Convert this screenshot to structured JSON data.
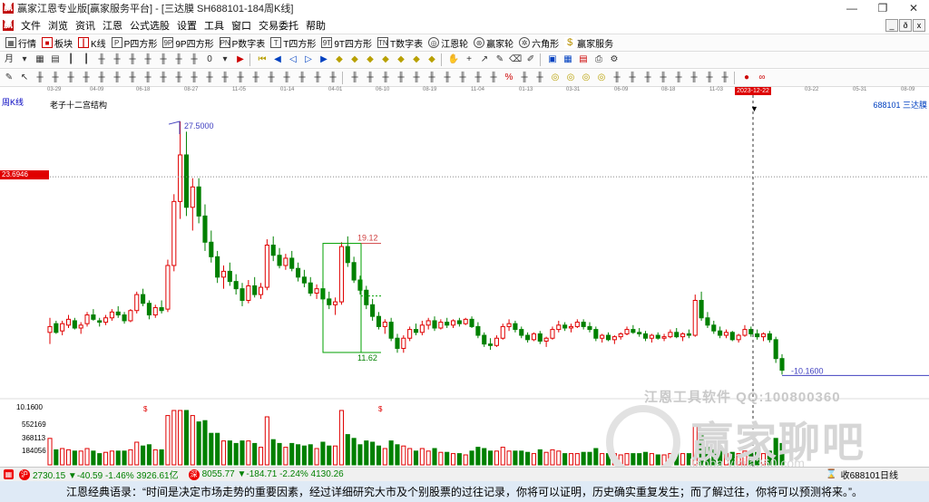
{
  "window": {
    "title": "赢家江恩专业版[赢家服务平台] - [三达膜  SH688101-184周K线]",
    "controls": [
      "—",
      "❐",
      "✕"
    ]
  },
  "menu": {
    "items": [
      "文件",
      "浏览",
      "资讯",
      "江恩",
      "公式选股",
      "设置",
      "工具",
      "窗口",
      "交易委托",
      "帮助"
    ],
    "right_controls": [
      "_",
      "ð",
      "x"
    ]
  },
  "toolbar1": [
    {
      "label": "行情",
      "icon": "grid-icon"
    },
    {
      "label": "板块",
      "icon": "blocks-icon"
    },
    {
      "label": "K线",
      "icon": "candle-icon"
    },
    {
      "label": "P四方形",
      "icon": "p-square-icon"
    },
    {
      "label": "9P四方形",
      "icon": "9p-square-icon"
    },
    {
      "label": "P数字表",
      "icon": "p-table-icon"
    },
    {
      "label": "T四方形",
      "icon": "t-square-icon"
    },
    {
      "label": "9T四方形",
      "icon": "9t-square-icon"
    },
    {
      "label": "T数字表",
      "icon": "t-table-icon"
    },
    {
      "label": "江恩轮",
      "icon": "gann-wheel-icon"
    },
    {
      "label": "赢家轮",
      "icon": "winner-wheel-icon"
    },
    {
      "label": "六角形",
      "icon": "hexagon-icon"
    },
    {
      "label": "赢家服务",
      "icon": "dollar-icon"
    }
  ],
  "chart": {
    "period_label": "周K线",
    "indicator_name": "老子十二宫结构",
    "stock_label": "688101  三达膜",
    "cursor_date": "2023-12-22",
    "dates": [
      "03-29",
      "04-09",
      "06-18",
      "08-27",
      "11-05",
      "01-14",
      "04-01",
      "06-10",
      "08-19",
      "11-04",
      "01-13",
      "03-31",
      "06-09",
      "08-18",
      "11-03",
      "2023-12-22",
      "03-22",
      "05-31",
      "08-09"
    ],
    "price_flag": "23.6946",
    "annotations": {
      "high": "27.5000",
      "box_top": "19.12",
      "box_bottom": "11.62",
      "low": "-10.1600"
    },
    "volume_labels": [
      "10.1600",
      "552169",
      "368113",
      "184056"
    ],
    "volume_markers": [
      "$",
      "$"
    ]
  },
  "chart_data": {
    "type": "candlestick",
    "ylim": [
      9.5,
      28.5
    ],
    "candles": [
      [
        13.0,
        14.0,
        12.2,
        13.4
      ],
      [
        13.6,
        13.8,
        12.9,
        13.0
      ],
      [
        13.1,
        13.8,
        12.8,
        13.6
      ],
      [
        13.5,
        14.2,
        13.3,
        13.9
      ],
      [
        13.8,
        14.0,
        13.2,
        13.3
      ],
      [
        13.3,
        13.7,
        12.9,
        13.5
      ],
      [
        13.6,
        14.4,
        13.4,
        14.2
      ],
      [
        14.2,
        14.6,
        13.8,
        13.9
      ],
      [
        13.8,
        14.0,
        13.4,
        13.7
      ],
      [
        13.7,
        14.2,
        13.5,
        14.0
      ],
      [
        14.0,
        14.6,
        13.8,
        14.4
      ],
      [
        14.4,
        14.8,
        14.0,
        14.2
      ],
      [
        14.2,
        14.4,
        13.6,
        13.8
      ],
      [
        13.8,
        14.6,
        13.7,
        14.5
      ],
      [
        14.5,
        15.8,
        14.3,
        15.6
      ],
      [
        15.6,
        16.0,
        14.8,
        15.0
      ],
      [
        15.0,
        15.2,
        13.9,
        14.2
      ],
      [
        14.2,
        14.9,
        14.0,
        14.7
      ],
      [
        14.7,
        15.2,
        14.3,
        14.5
      ],
      [
        14.6,
        18.0,
        14.4,
        17.6
      ],
      [
        17.6,
        22.5,
        17.2,
        22.0
      ],
      [
        22.0,
        27.5,
        20.8,
        25.2
      ],
      [
        25.2,
        26.8,
        21.0,
        21.6
      ],
      [
        21.6,
        23.6,
        20.0,
        23.0
      ],
      [
        23.0,
        23.6,
        20.5,
        21.0
      ],
      [
        21.0,
        21.8,
        18.6,
        19.2
      ],
      [
        19.2,
        20.0,
        17.8,
        18.2
      ],
      [
        18.2,
        18.6,
        16.4,
        16.8
      ],
      [
        16.8,
        17.6,
        16.0,
        17.2
      ],
      [
        17.2,
        17.8,
        16.2,
        16.5
      ],
      [
        16.5,
        17.0,
        15.6,
        16.0
      ],
      [
        16.0,
        16.4,
        14.8,
        15.2
      ],
      [
        15.2,
        16.6,
        15.0,
        16.2
      ],
      [
        16.2,
        16.8,
        15.4,
        15.6
      ],
      [
        15.6,
        16.4,
        15.3,
        16.1
      ],
      [
        16.1,
        19.4,
        15.9,
        19.0
      ],
      [
        19.0,
        19.6,
        17.9,
        18.3
      ],
      [
        18.3,
        18.8,
        17.4,
        17.6
      ],
      [
        17.6,
        18.4,
        17.3,
        18.1
      ],
      [
        18.1,
        18.6,
        17.2,
        17.4
      ],
      [
        17.4,
        17.8,
        16.5,
        16.8
      ],
      [
        16.8,
        17.3,
        16.1,
        16.4
      ],
      [
        16.4,
        16.8,
        15.5,
        15.7
      ],
      [
        15.7,
        16.3,
        15.3,
        16.0
      ],
      [
        16.0,
        16.5,
        15.0,
        15.3
      ],
      [
        15.3,
        15.8,
        14.6,
        14.9
      ],
      [
        14.9,
        15.4,
        14.2,
        15.1
      ],
      [
        15.1,
        19.2,
        14.9,
        18.9
      ],
      [
        18.9,
        19.6,
        17.5,
        17.8
      ],
      [
        17.8,
        18.2,
        16.4,
        16.6
      ],
      [
        16.6,
        16.9,
        15.6,
        15.9
      ],
      [
        15.9,
        16.2,
        14.6,
        14.9
      ],
      [
        14.9,
        15.3,
        13.8,
        14.1
      ],
      [
        14.1,
        14.4,
        13.2,
        13.4
      ],
      [
        13.4,
        13.9,
        12.9,
        13.7
      ],
      [
        13.7,
        14.0,
        12.4,
        12.6
      ],
      [
        12.6,
        12.9,
        11.6,
        11.9
      ],
      [
        11.9,
        12.8,
        11.6,
        12.6
      ],
      [
        12.6,
        13.4,
        12.4,
        13.2
      ],
      [
        13.2,
        13.6,
        12.8,
        13.0
      ],
      [
        13.0,
        13.8,
        12.8,
        13.5
      ],
      [
        13.5,
        14.0,
        13.2,
        13.8
      ],
      [
        13.8,
        14.1,
        13.1,
        13.3
      ],
      [
        13.3,
        13.9,
        13.2,
        13.7
      ],
      [
        13.7,
        14.0,
        13.3,
        13.5
      ],
      [
        13.5,
        13.9,
        13.3,
        13.8
      ],
      [
        13.8,
        14.0,
        13.4,
        13.6
      ],
      [
        13.6,
        14.0,
        13.5,
        13.9
      ],
      [
        13.9,
        14.1,
        13.3,
        13.4
      ],
      [
        13.4,
        13.7,
        12.6,
        12.8
      ],
      [
        12.8,
        13.0,
        12.0,
        12.2
      ],
      [
        12.2,
        12.6,
        11.8,
        12.1
      ],
      [
        12.1,
        12.8,
        12.0,
        12.6
      ],
      [
        12.6,
        13.6,
        12.5,
        13.4
      ],
      [
        13.4,
        13.9,
        13.1,
        13.6
      ],
      [
        13.6,
        13.8,
        13.0,
        13.2
      ],
      [
        13.2,
        13.4,
        12.6,
        12.8
      ],
      [
        12.8,
        13.0,
        12.3,
        12.5
      ],
      [
        12.5,
        13.0,
        12.4,
        12.9
      ],
      [
        12.9,
        13.1,
        12.2,
        12.4
      ],
      [
        12.4,
        12.7,
        12.0,
        12.6
      ],
      [
        12.6,
        13.4,
        12.5,
        13.2
      ],
      [
        13.2,
        13.8,
        13.0,
        13.5
      ],
      [
        13.5,
        13.7,
        13.1,
        13.3
      ],
      [
        13.3,
        13.6,
        13.0,
        13.4
      ],
      [
        13.4,
        13.9,
        13.3,
        13.7
      ],
      [
        13.7,
        13.9,
        13.2,
        13.4
      ],
      [
        13.4,
        13.7,
        13.0,
        13.2
      ],
      [
        13.2,
        13.4,
        12.4,
        12.6
      ],
      [
        12.6,
        12.9,
        12.3,
        12.8
      ],
      [
        12.8,
        13.0,
        12.4,
        12.5
      ],
      [
        12.5,
        12.8,
        12.2,
        12.7
      ],
      [
        12.7,
        13.0,
        12.5,
        12.9
      ],
      [
        12.9,
        13.4,
        12.8,
        13.2
      ],
      [
        13.2,
        13.5,
        12.9,
        13.0
      ],
      [
        13.0,
        13.3,
        12.7,
        12.9
      ],
      [
        12.9,
        13.1,
        12.4,
        12.6
      ],
      [
        12.6,
        12.9,
        12.3,
        12.8
      ],
      [
        12.8,
        13.0,
        12.5,
        12.6
      ],
      [
        12.6,
        12.9,
        12.4,
        12.7
      ],
      [
        12.7,
        13.2,
        12.6,
        13.0
      ],
      [
        13.0,
        13.3,
        12.6,
        12.7
      ],
      [
        12.7,
        13.0,
        12.4,
        12.9
      ],
      [
        12.9,
        13.2,
        12.6,
        12.8
      ],
      [
        12.8,
        15.6,
        12.7,
        15.2
      ],
      [
        15.2,
        15.8,
        13.8,
        14.0
      ],
      [
        14.0,
        14.4,
        13.3,
        13.5
      ],
      [
        13.5,
        13.8,
        12.9,
        13.1
      ],
      [
        13.1,
        13.4,
        12.6,
        12.8
      ],
      [
        12.8,
        13.2,
        12.6,
        13.0
      ],
      [
        13.0,
        13.1,
        12.4,
        12.5
      ],
      [
        12.5,
        12.9,
        12.3,
        12.8
      ],
      [
        12.8,
        13.5,
        12.7,
        13.2
      ],
      [
        13.2,
        13.4,
        12.7,
        12.9
      ],
      [
        12.9,
        13.2,
        12.5,
        12.7
      ],
      [
        12.7,
        13.0,
        12.4,
        12.9
      ],
      [
        12.9,
        13.1,
        12.3,
        12.5
      ],
      [
        12.5,
        12.7,
        10.9,
        11.2
      ],
      [
        11.2,
        11.5,
        10.1,
        10.4
      ]
    ]
  },
  "status": {
    "sh_icon": "沪",
    "sh_text": "2730.15 ▼-40.59 -1.46% 3926.61亿",
    "sz_icon": "深",
    "sz_text": "8055.77 ▼-184.71 -2.24% 4130.26",
    "right_text": "收688101日线"
  },
  "watermark": {
    "line1": "江恩工具软件 QQ:100800360",
    "line2": "赢家聊吧",
    "line3": "liaoba.yinjia360.com"
  },
  "quote": "江恩经典语录：“时间是决定市场走势的重要因素，经过详细研究大市及个别股票的过往记录，你将可以证明，历史确实重复发生；而了解过往，你将可以预测将来。”。"
}
